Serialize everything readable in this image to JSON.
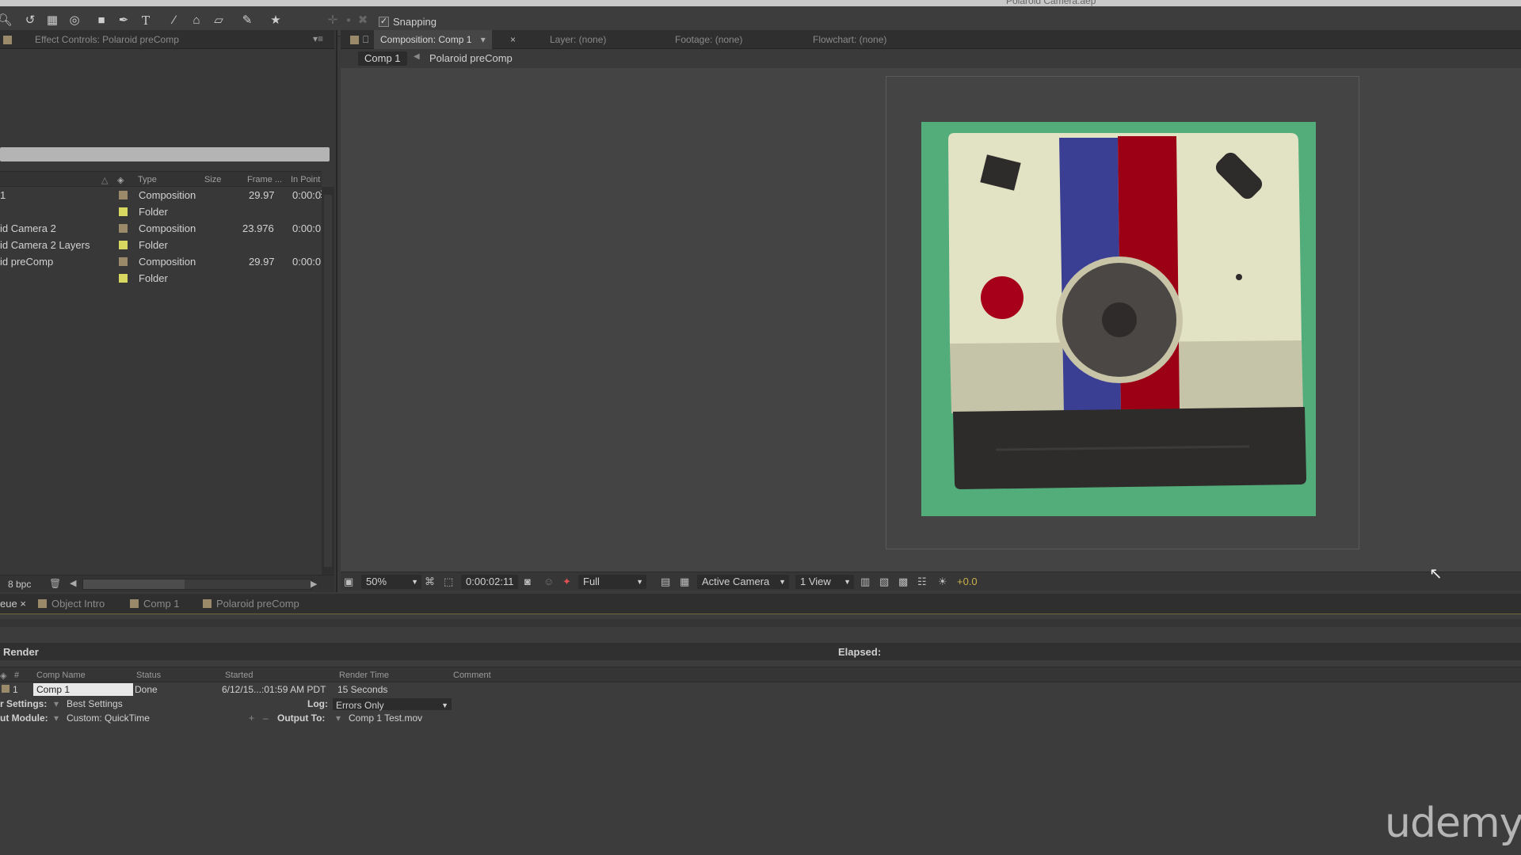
{
  "window": {
    "title": "Polaroid Camera.aep"
  },
  "toolbar": {
    "snapping_label": "Snapping",
    "snapping_checked": true,
    "tools": [
      "zoom-tool",
      "rotate-tool",
      "camera-tool",
      "pan-behind-tool",
      "rectangle-tool",
      "pen-tool",
      "type-tool",
      "brush-tool",
      "clone-stamp-tool",
      "eraser-tool",
      "roto-brush-tool",
      "puppet-tool"
    ]
  },
  "effect_controls": {
    "tab_label": "Effect Controls: Polaroid preComp"
  },
  "project": {
    "columns": [
      "Type",
      "Size",
      "Frame ...",
      "In Point"
    ],
    "rows": [
      {
        "name": "1",
        "color": "#9a8a6a",
        "type": "Composition",
        "frame_rate": "29.97",
        "in_point": "0:00:0"
      },
      {
        "name": "",
        "color": "#d8d860",
        "type": "Folder",
        "frame_rate": "",
        "in_point": ""
      },
      {
        "name": "id Camera 2",
        "color": "#9a8a6a",
        "type": "Composition",
        "frame_rate": "23.976",
        "in_point": "0:00:0"
      },
      {
        "name": "id Camera 2 Layers",
        "color": "#d8d860",
        "type": "Folder",
        "frame_rate": "",
        "in_point": ""
      },
      {
        "name": "id preComp",
        "color": "#9a8a6a",
        "type": "Composition",
        "frame_rate": "29.97",
        "in_point": "0:00:0"
      },
      {
        "name": "",
        "color": "#d8d860",
        "type": "Folder",
        "frame_rate": "",
        "in_point": ""
      }
    ],
    "bpc_label": "8 bpc"
  },
  "composition": {
    "tabs": {
      "composition": "Composition: Comp 1",
      "layer": "Layer: (none)",
      "footage": "Footage: (none)",
      "flowchart": "Flowchart: (none)"
    },
    "breadcrumb": [
      "Comp 1",
      "Polaroid preComp"
    ],
    "viewer_footer": {
      "zoom": "50%",
      "timecode": "0:00:02:11",
      "resolution": "Full",
      "camera": "Active Camera",
      "view_layout": "1 View",
      "exposure": "+0.0"
    },
    "art_colors": {
      "background": "#52ad7a",
      "body_top": "#e2e2c4",
      "body_mid": "#c6c4a8",
      "stripe_blue": "#3b3f94",
      "stripe_red": "#9c0014",
      "slot": "#2e2c2b",
      "lens_ring": "#c8c4a8",
      "lens": "#4a4745",
      "lens_center": "#2e2b2a",
      "button_red": "#a7001a"
    }
  },
  "bottom_tabs": [
    "eue",
    "Object Intro",
    "Comp 1",
    "Polaroid preComp"
  ],
  "render_queue": {
    "render_label": "Render",
    "elapsed_label": "Elapsed:",
    "columns": [
      "#",
      "Comp Name",
      "Status",
      "Started",
      "Render Time",
      "Comment"
    ],
    "item": {
      "number": "1",
      "comp_name": "Comp 1",
      "status": "Done",
      "started": "6/12/15...:01:59 AM PDT",
      "render_time": "15 Seconds"
    },
    "render_settings_label": "r Settings:",
    "render_settings_value": "Best Settings",
    "log_label": "Log:",
    "log_value": "Errors Only",
    "output_module_label": "ut Module:",
    "output_module_value": "Custom: QuickTime",
    "output_to_label": "Output To:",
    "output_to_value": "Comp 1 Test.mov"
  },
  "watermark": "udemy"
}
